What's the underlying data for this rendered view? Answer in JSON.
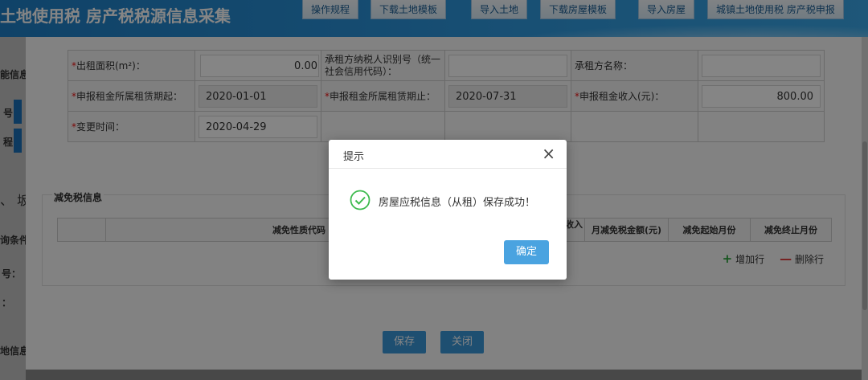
{
  "header": {
    "title": "土地使用税 房产税税源信息采集",
    "buttons": [
      "操作规程",
      "下载土地模板",
      "导入土地",
      "下载房屋模板",
      "导入房屋",
      "城镇土地使用税 房产税申报"
    ]
  },
  "left_strip": {
    "texts": [
      "能信息",
      "号：",
      "程：",
      "、 坂",
      "询条件",
      "号：",
      "：",
      "地信息"
    ]
  },
  "form": {
    "rows": [
      {
        "label1": "出租面积(m²)：",
        "value1": "0.00",
        "label2": "承租方纳税人识别号（统一社会信用代码）：",
        "value2": "",
        "label3": "承租方名称：",
        "value3": ""
      },
      {
        "label1": "申报租金所属租赁期起：",
        "value1": "2020-01-01",
        "label2": "申报租金所属租赁期止：",
        "value2": "2020-07-31",
        "label3": "申报租金收入(元)：",
        "value3": "800.00"
      },
      {
        "label1": "变更时间：",
        "value1": "2020-04-29"
      }
    ]
  },
  "exemption": {
    "title": "减免税信息",
    "columns": [
      "",
      "减免性质代码",
      "收入",
      "月减免税金额(元)",
      "减免起始月份",
      "减免终止月份"
    ],
    "add_row": "增加行",
    "delete_row": "删除行"
  },
  "actions": {
    "save": "保存",
    "close": "关闭"
  },
  "modal": {
    "title": "提示",
    "message": "房屋应税信息（从租）保存成功！",
    "ok": "确定",
    "close_icon": "close-icon",
    "status_icon": "success-check-icon"
  },
  "colors": {
    "header_blue": "#2d97dd",
    "button_blue": "#3b97d9",
    "success_green": "#3dba4e"
  }
}
